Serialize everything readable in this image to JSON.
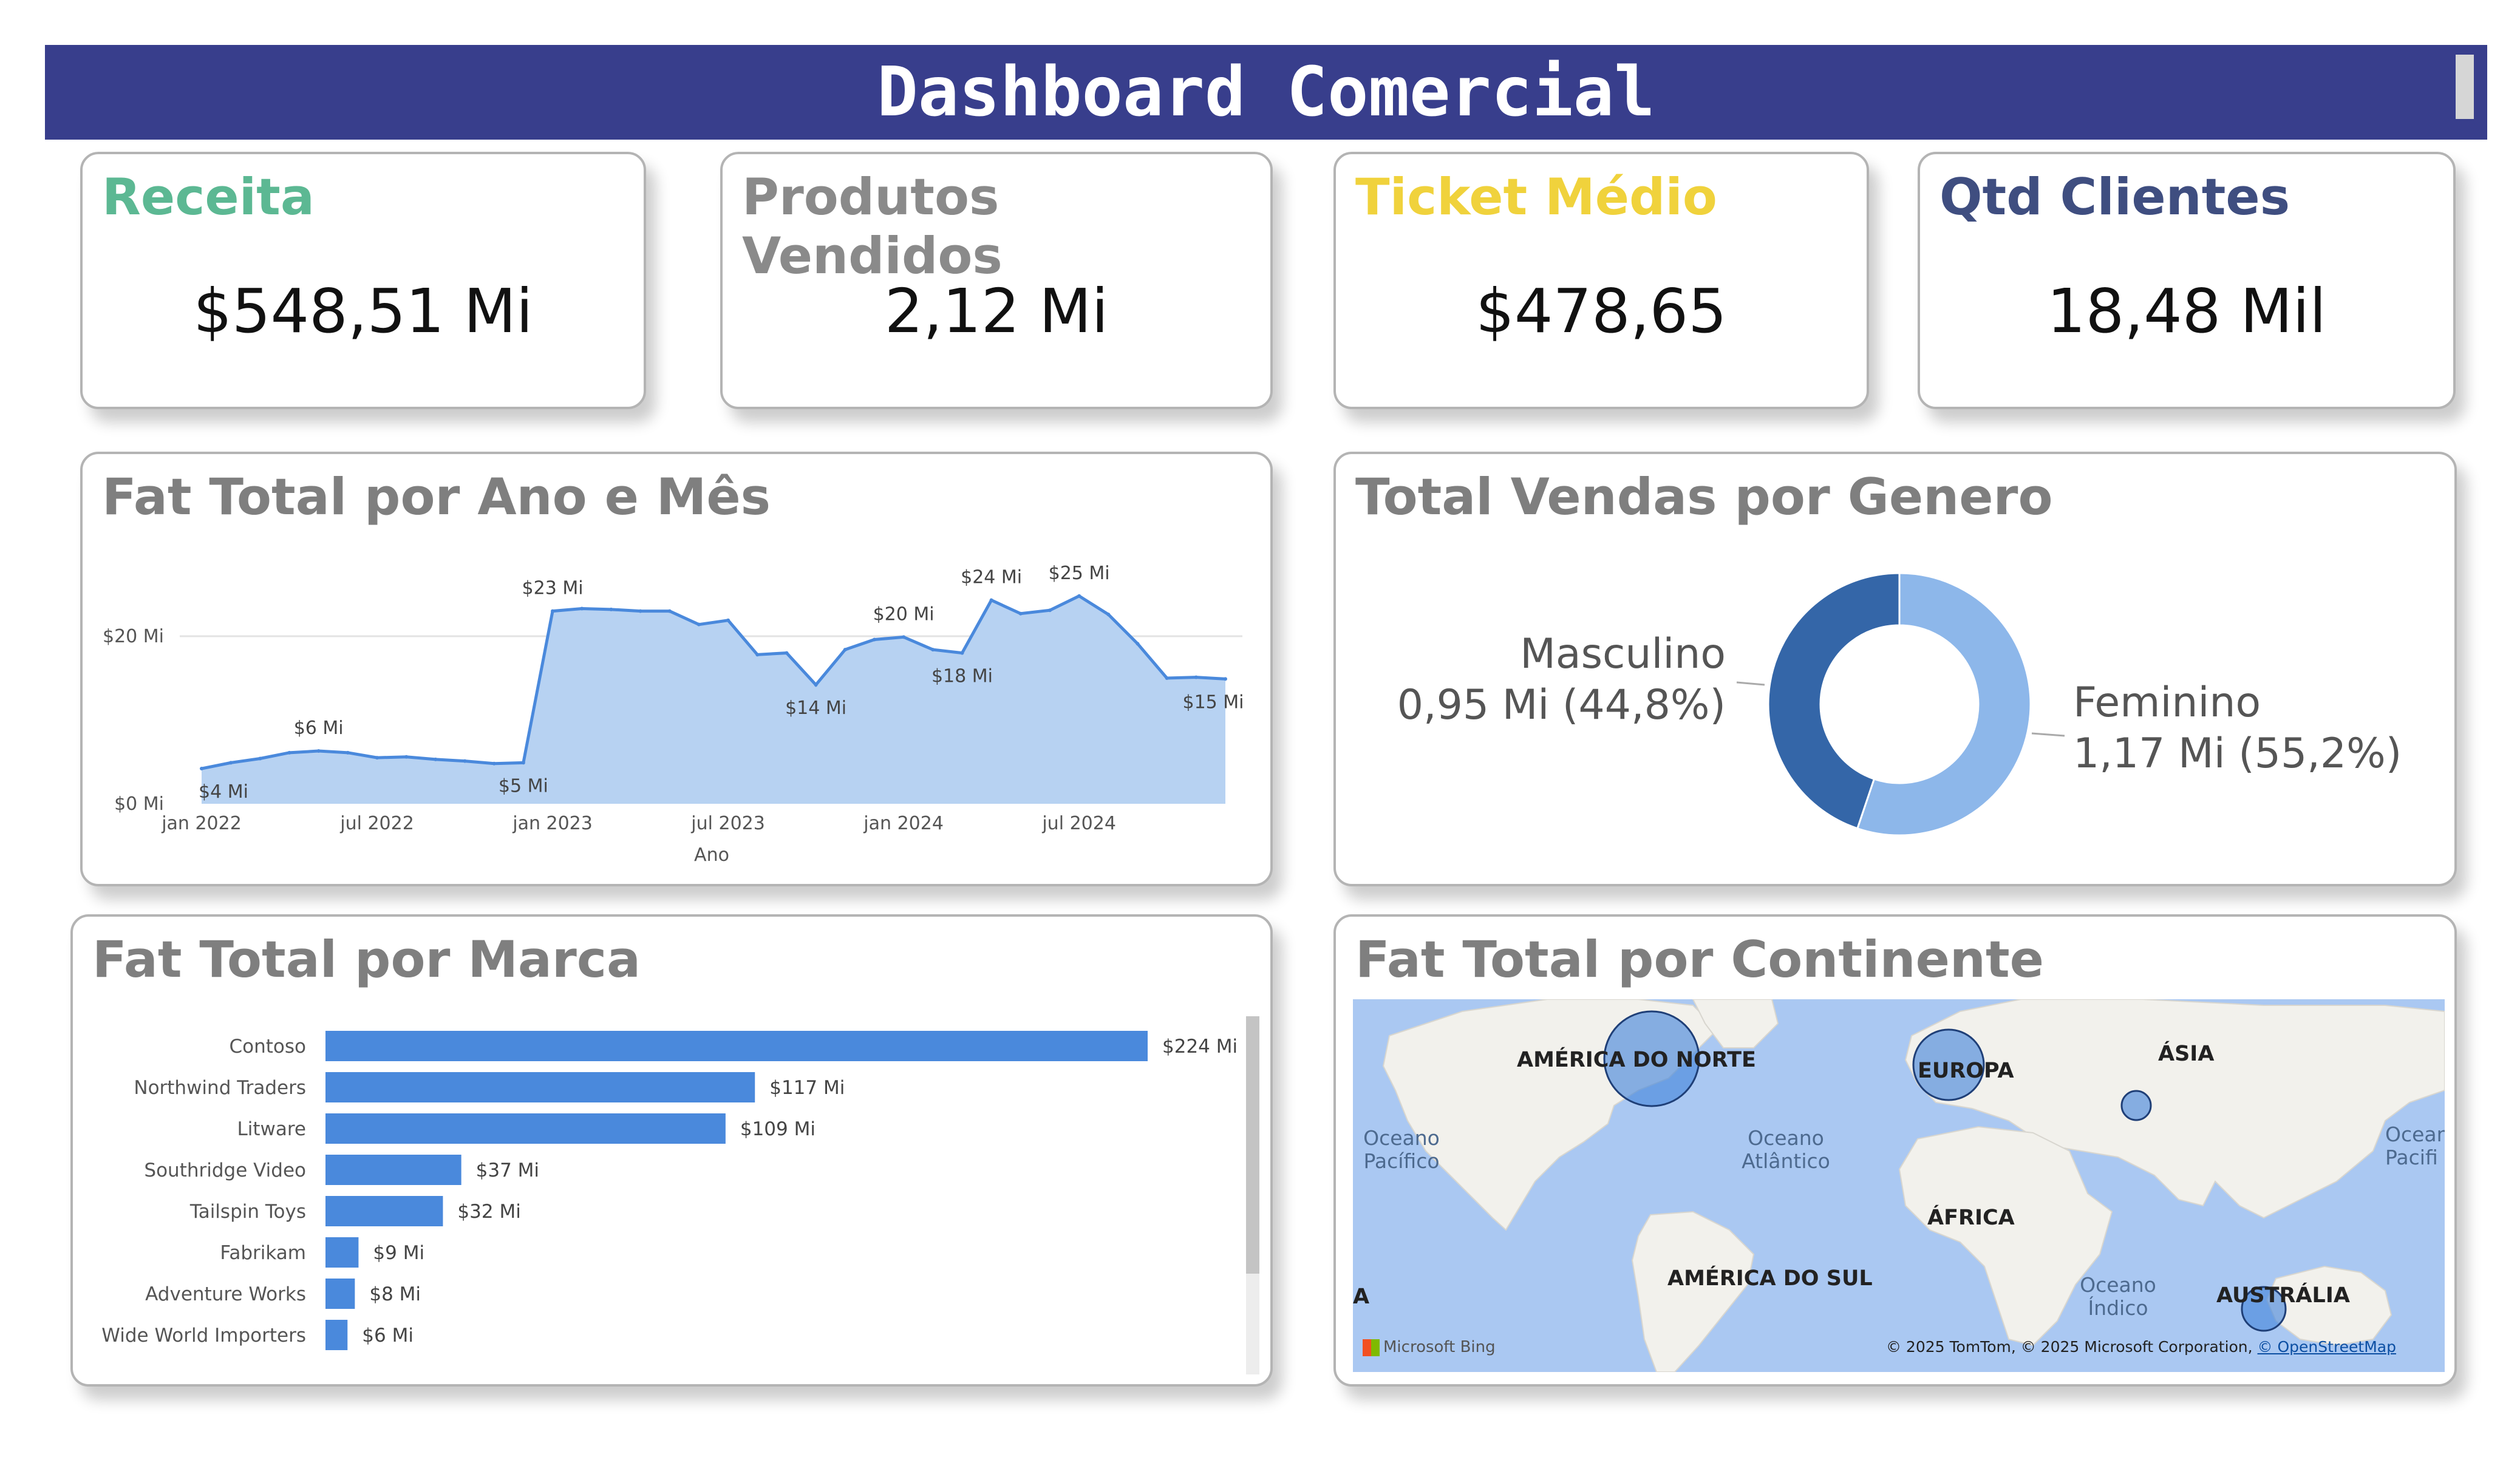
{
  "header": {
    "title": "Dashboard Comercial"
  },
  "kpis": [
    {
      "title": "Receita",
      "value": "$548,51 Mi",
      "color": "#5cb893"
    },
    {
      "title": "Produtos Vendidos",
      "value": "2,12 Mi",
      "color": "#8a8a8a"
    },
    {
      "title": "Ticket Médio",
      "value": "$478,65",
      "color": "#f0d23c"
    },
    {
      "title": "Qtd Clientes",
      "value": "18,48 Mil",
      "color": "#3f4e80"
    }
  ],
  "panels": {
    "area_title": "Fat Total por Ano e Mês",
    "donut_title": "Total Vendas por Genero",
    "bar_title": "Fat Total por Marca",
    "map_title": "Fat Total por Continente"
  },
  "colors": {
    "bar": "#4a89dc",
    "area_fill": "#b7d2f2",
    "area_line": "#4a89dc",
    "donut_dark": "#3466a8",
    "donut_light": "#8db7ea",
    "map_water": "#aac8f2"
  },
  "chart_data": [
    {
      "type": "area",
      "title": "Fat Total por Ano e Mês",
      "xlabel": "Ano",
      "ylabel": "",
      "ylim": [
        0,
        27
      ],
      "y_ticks": [
        {
          "value": 0,
          "label": "$0 Mi"
        },
        {
          "value": 20,
          "label": "$20 Mi"
        }
      ],
      "x_ticks": [
        {
          "index": 0,
          "label": "jan 2022"
        },
        {
          "index": 6,
          "label": "jul 2022"
        },
        {
          "index": 12,
          "label": "jan 2023"
        },
        {
          "index": 18,
          "label": "jul 2023"
        },
        {
          "index": 24,
          "label": "jan 2024"
        },
        {
          "index": 30,
          "label": "jul 2024"
        }
      ],
      "x": [
        "jan 2022",
        "fev 2022",
        "mar 2022",
        "abr 2022",
        "mai 2022",
        "jun 2022",
        "jul 2022",
        "ago 2022",
        "set 2022",
        "out 2022",
        "nov 2022",
        "dez 2022",
        "jan 2023",
        "fev 2023",
        "mar 2023",
        "abr 2023",
        "mai 2023",
        "jun 2023",
        "jul 2023",
        "ago 2023",
        "set 2023",
        "out 2023",
        "nov 2023",
        "dez 2023",
        "jan 2024",
        "fev 2024",
        "mar 2024",
        "abr 2024",
        "mai 2024",
        "jun 2024",
        "jul 2024",
        "ago 2024",
        "set 2024",
        "out 2024",
        "nov 2024",
        "dez 2024"
      ],
      "values": [
        4.2,
        4.9,
        5.4,
        6.1,
        6.3,
        6.1,
        5.5,
        5.6,
        5.3,
        5.1,
        4.8,
        4.9,
        23.0,
        23.3,
        23.2,
        23.0,
        23.0,
        21.4,
        21.9,
        17.8,
        18.0,
        14.2,
        18.4,
        19.6,
        19.9,
        18.4,
        18.0,
        24.3,
        22.7,
        23.1,
        24.8,
        22.6,
        19.1,
        15.0,
        15.1,
        14.9
      ],
      "data_labels": [
        {
          "index": 0,
          "label": "$4 Mi"
        },
        {
          "index": 4,
          "label": "$6 Mi"
        },
        {
          "index": 11,
          "label": "$5 Mi"
        },
        {
          "index": 12,
          "label": "$23 Mi"
        },
        {
          "index": 21,
          "label": "$14 Mi"
        },
        {
          "index": 24,
          "label": "$20 Mi"
        },
        {
          "index": 26,
          "label": "$18 Mi"
        },
        {
          "index": 27,
          "label": "$24 Mi"
        },
        {
          "index": 30,
          "label": "$25 Mi"
        },
        {
          "index": 35,
          "label": "$15 Mi"
        }
      ],
      "grid": true
    },
    {
      "type": "pie",
      "title": "Total Vendas por Genero",
      "donut": true,
      "slices": [
        {
          "name": "Feminino",
          "value": 1.17,
          "percent": 55.2,
          "label": "1,17 Mi (55,2%)"
        },
        {
          "name": "Masculino",
          "value": 0.95,
          "percent": 44.8,
          "label": "0,95 Mi (44,8%)"
        }
      ]
    },
    {
      "type": "bar",
      "orientation": "horizontal",
      "title": "Fat Total por Marca",
      "categories": [
        "Contoso",
        "Northwind Traders",
        "Litware",
        "Southridge Video",
        "Tailspin Toys",
        "Fabrikam",
        "Adventure Works",
        "Wide World Importers"
      ],
      "values": [
        224,
        117,
        109,
        37,
        32,
        9,
        8,
        6
      ],
      "labels": [
        "$224 Mi",
        "$117 Mi",
        "$109 Mi",
        "$37 Mi",
        "$32 Mi",
        "$9 Mi",
        "$8 Mi",
        "$6 Mi"
      ],
      "xlim": [
        0,
        224
      ]
    }
  ],
  "map": {
    "labels": {
      "north_america": "AMÉRICA DO NORTE",
      "europe": "EUROPA",
      "asia": "ÁSIA",
      "africa": "ÁFRICA",
      "south_america": "AMÉRICA DO SUL",
      "australia": "AUSTRÁLIA",
      "pacific_1": "Oceano",
      "pacific_2": "Pacífico",
      "atlantic_1": "Oceano",
      "atlantic_2": "Atlântico",
      "indian_1": "Oceano",
      "indian_2": "Índico",
      "pacific_edge_1": "Ocean",
      "pacific_edge_2": "Pacifi",
      "edge_letter": "A"
    },
    "bing_label": "Microsoft Bing",
    "attribution": "© 2025 TomTom, © 2025 Microsoft Corporation, ",
    "attribution_link": "© OpenStreetMap"
  }
}
